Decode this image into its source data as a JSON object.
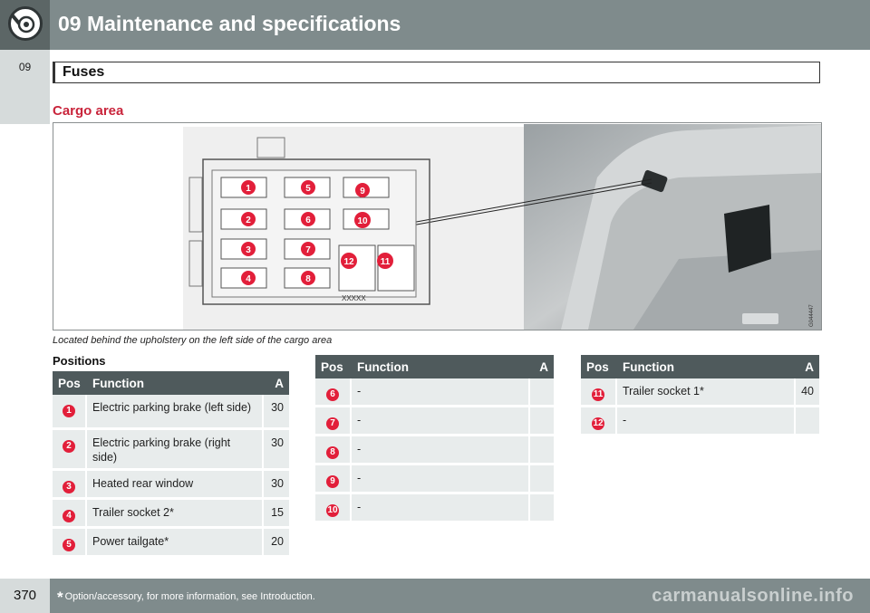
{
  "header": {
    "title": "09 Maintenance and specifications",
    "icon": "wrench-gear-icon"
  },
  "side_tab": {
    "label": "09"
  },
  "section": {
    "title": "Fuses"
  },
  "subheading": "Cargo area",
  "figure": {
    "fuse_box_label": "XXXXX",
    "figure_code": "G044447",
    "fuse_markers": [
      "1",
      "2",
      "3",
      "4",
      "5",
      "6",
      "7",
      "8",
      "9",
      "10",
      "11",
      "12"
    ]
  },
  "caption": "Located behind the upholstery on the left side of the cargo area",
  "positions_heading": "Positions",
  "table_headers": {
    "pos": "Pos",
    "function": "Function",
    "amp": "A"
  },
  "tables": [
    {
      "rows": [
        {
          "pos": "1",
          "function": "Electric parking brake (left side)",
          "amp": "30"
        },
        {
          "pos": "2",
          "function": "Electric parking brake (right side)",
          "amp": "30"
        },
        {
          "pos": "3",
          "function": "Heated rear window",
          "amp": "30"
        },
        {
          "pos": "4",
          "function": "Trailer socket 2*",
          "amp": "15"
        },
        {
          "pos": "5",
          "function": "Power tailgate*",
          "amp": "20"
        }
      ]
    },
    {
      "rows": [
        {
          "pos": "6",
          "function": "-",
          "amp": ""
        },
        {
          "pos": "7",
          "function": "-",
          "amp": ""
        },
        {
          "pos": "8",
          "function": "-",
          "amp": ""
        },
        {
          "pos": "9",
          "function": "-",
          "amp": ""
        },
        {
          "pos": "10",
          "function": "-",
          "amp": ""
        }
      ]
    },
    {
      "rows": [
        {
          "pos": "11",
          "function": "Trailer socket 1*",
          "amp": "40"
        },
        {
          "pos": "12",
          "function": "-",
          "amp": ""
        }
      ]
    }
  ],
  "footer": {
    "page_number": "370",
    "star": "*",
    "note": "Option/accessory, for more information, see Introduction.",
    "watermark": "carmanualsonline.info"
  },
  "colors": {
    "header_bg": "#7f8b8c",
    "accent_red": "#c9243b",
    "badge_red": "#e21f3a",
    "table_header_bg": "#4f5a5c",
    "table_row_bg": "#e8ecec"
  }
}
